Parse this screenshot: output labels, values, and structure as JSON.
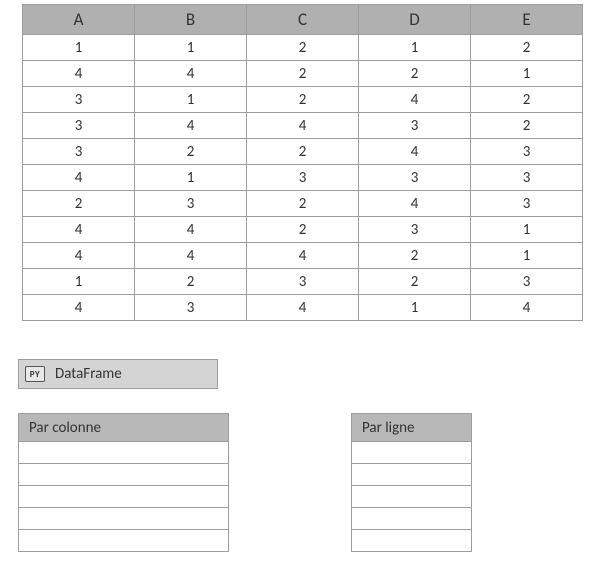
{
  "main_table": {
    "headers": [
      "A",
      "B",
      "C",
      "D",
      "E"
    ],
    "rows": [
      [
        "1",
        "1",
        "2",
        "1",
        "2"
      ],
      [
        "4",
        "4",
        "2",
        "2",
        "1"
      ],
      [
        "3",
        "1",
        "2",
        "4",
        "2"
      ],
      [
        "3",
        "4",
        "4",
        "3",
        "2"
      ],
      [
        "3",
        "2",
        "2",
        "4",
        "3"
      ],
      [
        "4",
        "1",
        "3",
        "3",
        "3"
      ],
      [
        "2",
        "3",
        "2",
        "4",
        "3"
      ],
      [
        "4",
        "4",
        "2",
        "3",
        "1"
      ],
      [
        "4",
        "4",
        "4",
        "2",
        "1"
      ],
      [
        "1",
        "2",
        "3",
        "2",
        "3"
      ],
      [
        "4",
        "3",
        "4",
        "1",
        "4"
      ]
    ]
  },
  "dataframe_badge": {
    "icon_label": "PY",
    "text": "DataFrame"
  },
  "col_table": {
    "header": "Par colonne",
    "rows": [
      "",
      "",
      "",
      "",
      ""
    ]
  },
  "row_table": {
    "header": "Par ligne",
    "rows": [
      "",
      "",
      "",
      "",
      ""
    ]
  },
  "chart_data": {
    "type": "table",
    "columns": [
      "A",
      "B",
      "C",
      "D",
      "E"
    ],
    "rows": [
      [
        1,
        1,
        2,
        1,
        2
      ],
      [
        4,
        4,
        2,
        2,
        1
      ],
      [
        3,
        1,
        2,
        4,
        2
      ],
      [
        3,
        4,
        4,
        3,
        2
      ],
      [
        3,
        2,
        2,
        4,
        3
      ],
      [
        4,
        1,
        3,
        3,
        3
      ],
      [
        2,
        3,
        2,
        4,
        3
      ],
      [
        4,
        4,
        2,
        3,
        1
      ],
      [
        4,
        4,
        4,
        2,
        1
      ],
      [
        1,
        2,
        3,
        2,
        3
      ],
      [
        4,
        3,
        4,
        1,
        4
      ]
    ]
  }
}
